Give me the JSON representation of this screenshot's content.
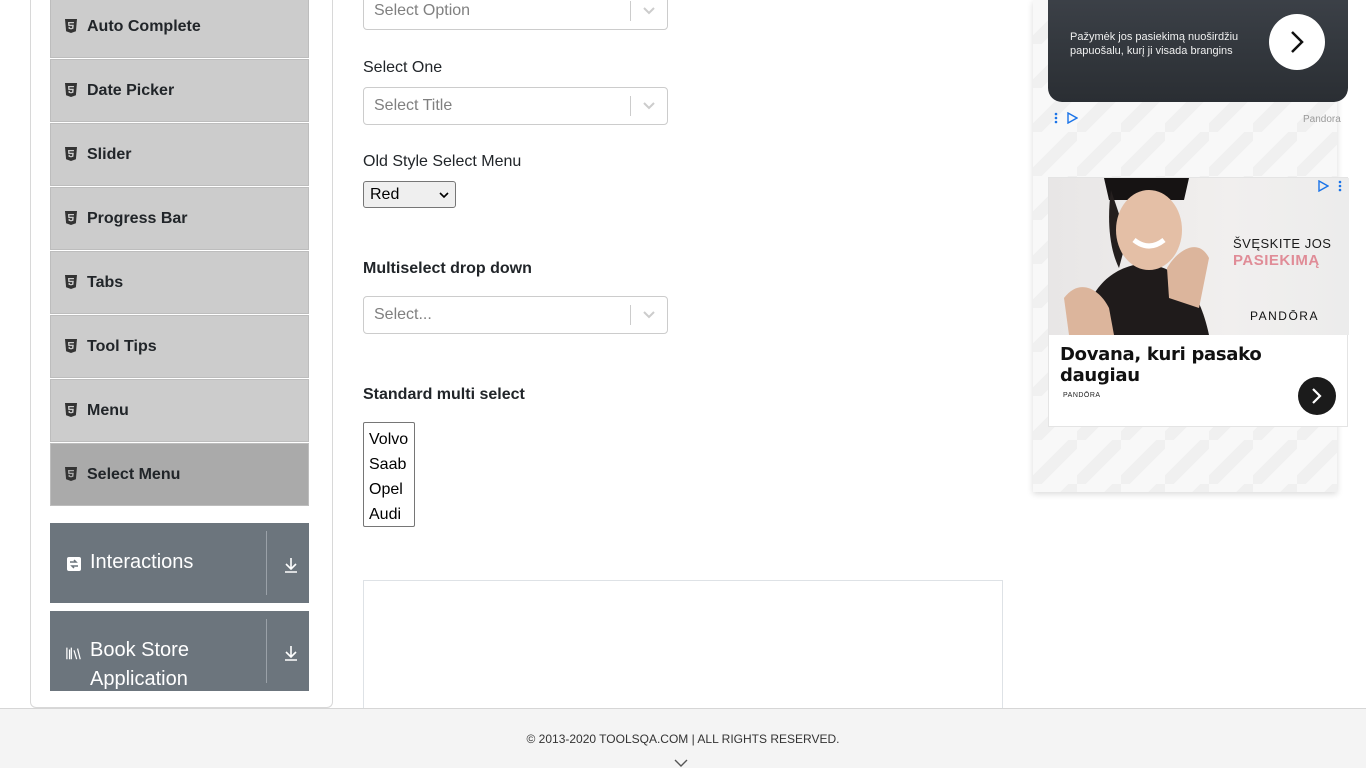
{
  "sidebar": {
    "items": [
      {
        "label": "Auto Complete"
      },
      {
        "label": "Date Picker"
      },
      {
        "label": "Slider"
      },
      {
        "label": "Progress Bar"
      },
      {
        "label": "Tabs"
      },
      {
        "label": "Tool Tips"
      },
      {
        "label": "Menu"
      },
      {
        "label": "Select Menu"
      }
    ],
    "active_index": 7,
    "groups": [
      {
        "label": "Interactions",
        "icon": "interactions-icon"
      },
      {
        "label": "Book Store",
        "label_line2": "Application",
        "icon": "book-store-icon"
      }
    ]
  },
  "main": {
    "select_option_placeholder": "Select Option",
    "select_one_label": "Select One",
    "select_title_placeholder": "Select Title",
    "old_style_label": "Old Style Select Menu",
    "old_style_value": "Red",
    "multiselect_label": "Multiselect drop down",
    "multiselect_placeholder": "Select...",
    "standard_multi_label": "Standard multi select",
    "cars": [
      "Volvo",
      "Saab",
      "Opel",
      "Audi"
    ]
  },
  "ads": {
    "top_text": "Pažymėk jos pasiekimą nuoširdžiu papuošalu, kurį ji visada brangins",
    "advertiser": "Pandora",
    "headline": "Dovana, kuri pasako daugiau",
    "slogan_line1": "ŠVĘSKITE JOS",
    "slogan_line2": "PASIEKIMĄ",
    "brand_big": "PANDŌRA",
    "brand_small": "PANDŌRA"
  },
  "footer": {
    "copyright": "© 2013-2020 TOOLSQA.COM | ALL RIGHTS RESERVED."
  },
  "colors": {
    "menu_bg": "#cccccc",
    "menu_active_bg": "#aaaaaa",
    "group_bg": "#6c757d",
    "pandora_pink": "#e08c97"
  }
}
